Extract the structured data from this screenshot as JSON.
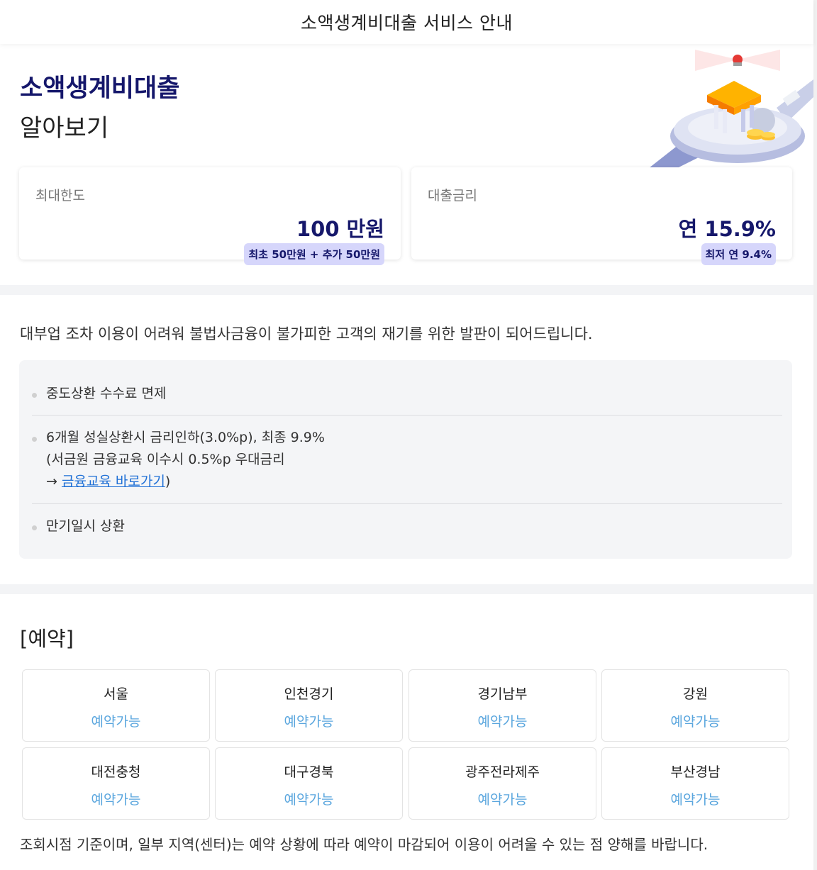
{
  "header": {
    "title": "소액생계비대출 서비스 안내"
  },
  "hero": {
    "title_highlight": "소액생계비대출",
    "title_sub": "알아보기",
    "illustration": "bank-building-illustration"
  },
  "cards": [
    {
      "label": "최대한도",
      "value": "100 만원",
      "badge": "최초 50만원 + 추가 50만원"
    },
    {
      "label": "대출금리",
      "value": "연 15.9%",
      "badge": "최저 연 9.4%"
    }
  ],
  "description": "대부업 조차 이용이 어려워 불법사금융이 불가피한 고객의 재기를 위한 발판이 되어드립니다.",
  "benefits": {
    "item1": "중도상환 수수료 면제",
    "item2_line1": "6개월 성실상환시 금리인하(3.0%p), 최종 9.9%",
    "item2_line2": "(서금원 금융교육 이수시 0.5%p 우대금리",
    "item2_arrow": "→ ",
    "item2_link": "금융교육 바로가기",
    "item2_close": ")",
    "item3": "만기일시 상환"
  },
  "reservation": {
    "title": "[예약]",
    "regions": [
      {
        "name": "서울",
        "status": "예약가능"
      },
      {
        "name": "인천경기",
        "status": "예약가능"
      },
      {
        "name": "경기남부",
        "status": "예약가능"
      },
      {
        "name": "강원",
        "status": "예약가능"
      },
      {
        "name": "대전충청",
        "status": "예약가능"
      },
      {
        "name": "대구경북",
        "status": "예약가능"
      },
      {
        "name": "광주전라제주",
        "status": "예약가능"
      },
      {
        "name": "부산경남",
        "status": "예약가능"
      }
    ],
    "footnote": "조회시점 기준이며, 일부 지역(센터)는 예약 상황에 따라 예약이 마감되어 이용이 어려울 수 있는 점 양해를 바랍니다."
  },
  "colors": {
    "navy": "#16186b",
    "highlight": "#a8d4ff",
    "badge_bg": "#d6d6fb",
    "status_blue": "#5aa6de",
    "link": "#1e6fd6"
  }
}
